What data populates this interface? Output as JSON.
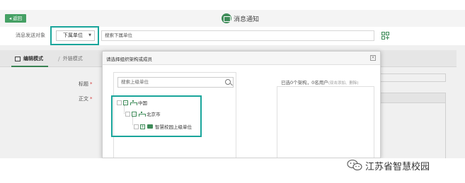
{
  "header": {
    "back_label": "◂ 返回",
    "title": "消息通知",
    "accent": "#3d8b58"
  },
  "target_row": {
    "label": "消息发送对象",
    "select_value": "下属单位",
    "search_placeholder": "搜索下属单位"
  },
  "tabs": [
    {
      "label": "编辑模式",
      "active": true
    },
    {
      "label": "外链模式",
      "active": false
    }
  ],
  "form": {
    "title_label": "标题",
    "body_label": "正文",
    "required_mark": "*"
  },
  "modal": {
    "title": "请选择组织架构或成员",
    "close_label": "×",
    "search_placeholder": "搜索上级单位",
    "tree": [
      {
        "label": "中国",
        "icon": "org-icon",
        "toggle": "−"
      },
      {
        "label": "北京市",
        "icon": "org-icon",
        "toggle": "−"
      },
      {
        "label": "智慧校园上级单位",
        "icon": "folder-icon",
        "toggle": "+"
      }
    ],
    "selected_info": "已选0个架构，0名用户",
    "selected_hint": "(双击添加、删除)",
    "highlight_color": "#1aa59b"
  },
  "watermark": {
    "text": "江苏省智慧校园"
  }
}
